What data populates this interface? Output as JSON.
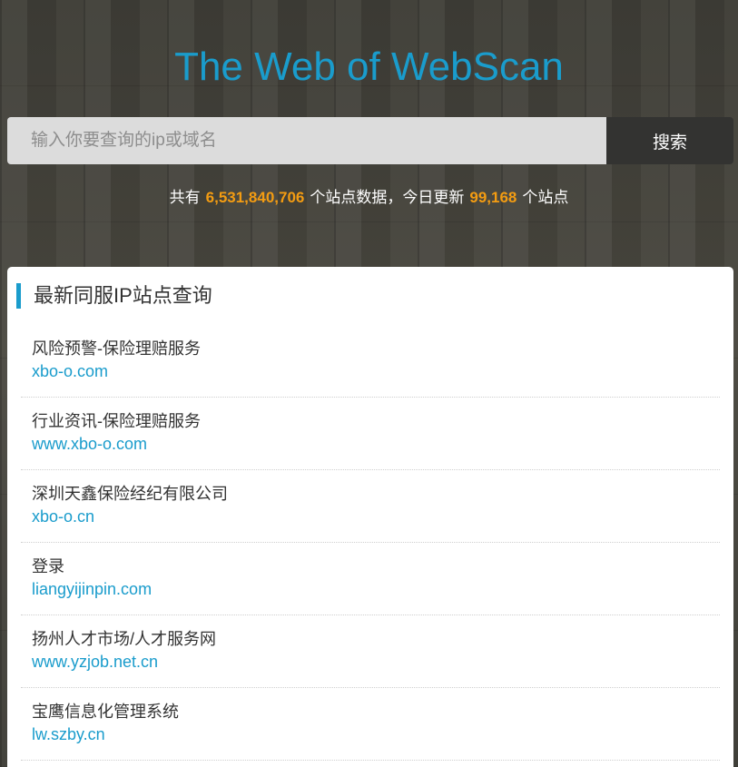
{
  "header": {
    "title": "The Web of WebScan",
    "search": {
      "placeholder": "输入你要查询的ip或域名",
      "value": "",
      "button_label": "搜索"
    },
    "stats": {
      "prefix": "共有",
      "total_sites": "6,531,840,706",
      "middle": "个站点数据，今日更新",
      "updated_today": "99,168",
      "suffix": "个站点"
    }
  },
  "panel": {
    "title": "最新同服IP站点查询",
    "items": [
      {
        "name": "风险预警-保险理赔服务",
        "domain": "xbo-o.com"
      },
      {
        "name": "行业资讯-保险理赔服务",
        "domain": "www.xbo-o.com"
      },
      {
        "name": "深圳天鑫保险经纪有限公司",
        "domain": "xbo-o.cn"
      },
      {
        "name": "登录",
        "domain": "liangyijinpin.com"
      },
      {
        "name": "扬州人才市场/人才服务网",
        "domain": "www.yzjob.net.cn"
      },
      {
        "name": "宝鹰信息化管理系统",
        "domain": "lw.szby.cn"
      }
    ]
  },
  "colors": {
    "accent": "#1a9ccc",
    "highlight_number": "#f39c12",
    "search_button_bg": "#333331",
    "search_input_bg": "#dcdcdc"
  }
}
